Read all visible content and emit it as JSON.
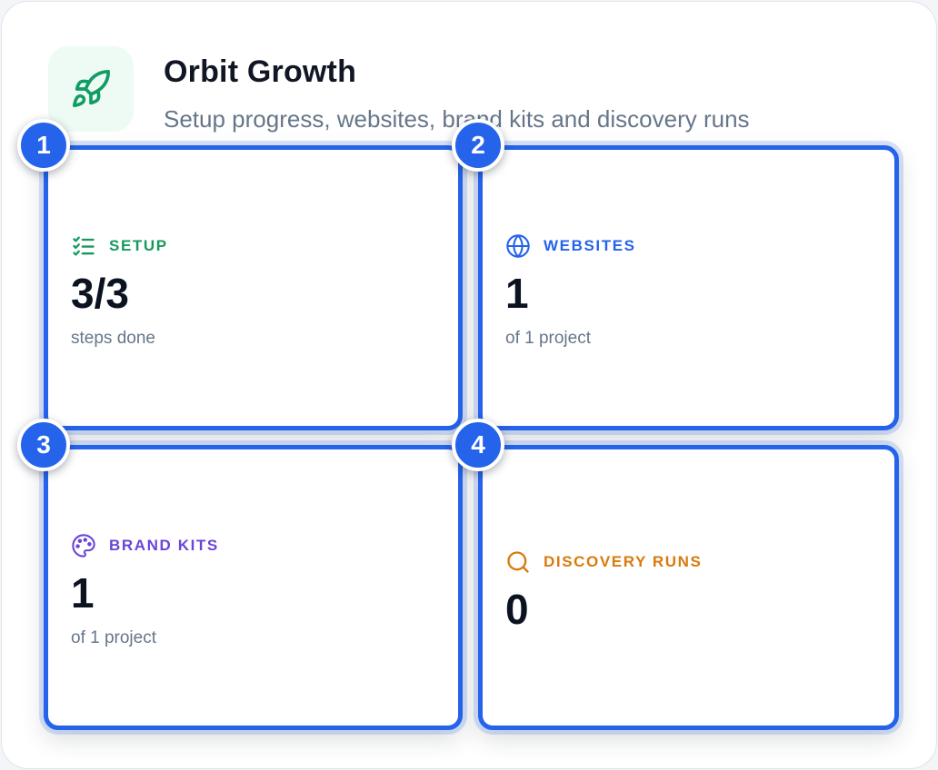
{
  "app": {
    "title": "Orbit Growth",
    "subtitle": "Setup progress, websites, brand kits and discovery runs",
    "icon": "rocket-icon",
    "accent": "#0f9d63"
  },
  "tiles": [
    {
      "badge": "1",
      "label": "SETUP",
      "value": "3/3",
      "caption": "steps done",
      "icon": "checklist-icon",
      "color": "#159a5e"
    },
    {
      "badge": "2",
      "label": "WEBSITES",
      "value": "1",
      "caption": "of 1 project",
      "icon": "globe-icon",
      "color": "#2563eb"
    },
    {
      "badge": "3",
      "label": "BRAND KITS",
      "value": "1",
      "caption": "of 1 project",
      "icon": "palette-icon",
      "color": "#6a45d8"
    },
    {
      "badge": "4",
      "label": "DISCOVERY RUNS",
      "value": "0",
      "caption": "",
      "icon": "search-icon",
      "color": "#d97a0c"
    }
  ],
  "colors": {
    "highlight": "#2563eb",
    "text_primary": "#0b1220",
    "text_muted": "#66768a"
  }
}
